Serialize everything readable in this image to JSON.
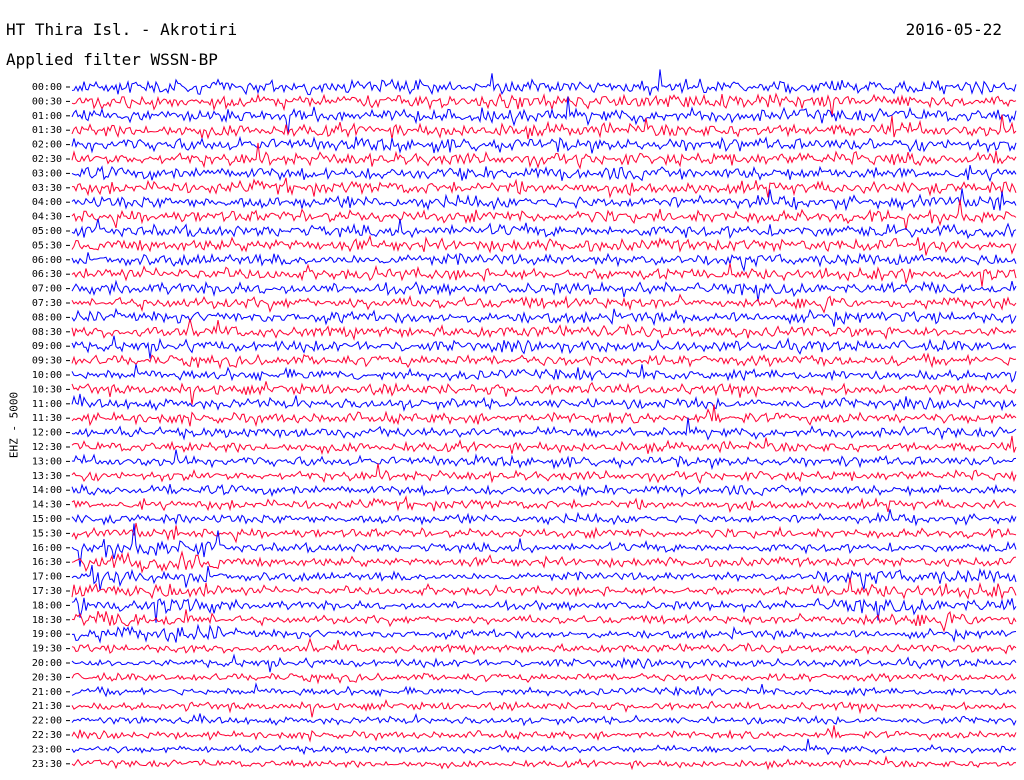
{
  "header": {
    "station_title": "HT Thira Isl. - Akrotiri",
    "date": "2016-05-22",
    "filter_label": "Applied filter WSSN-BP",
    "channel_label": "EHZ - 5000"
  },
  "colors": {
    "trace_a": "#0000ff",
    "trace_b": "#ff0033",
    "background": "#ffffff",
    "text": "#000000"
  },
  "chart_data": {
    "type": "line",
    "description_type": "helicorder",
    "y_tick_labels": [
      "00:00",
      "00:30",
      "01:00",
      "01:30",
      "02:00",
      "02:30",
      "03:00",
      "03:30",
      "04:00",
      "04:30",
      "05:00",
      "05:30",
      "06:00",
      "06:30",
      "07:00",
      "07:30",
      "08:00",
      "08:30",
      "09:00",
      "09:30",
      "10:00",
      "10:30",
      "11:00",
      "11:30",
      "12:00",
      "12:30",
      "13:00",
      "13:30",
      "14:00",
      "14:30",
      "15:00",
      "15:30",
      "16:00",
      "16:30",
      "17:00",
      "17:30",
      "18:00",
      "18:30",
      "19:00",
      "19:30",
      "20:00",
      "20:30",
      "21:00",
      "21:30",
      "22:00",
      "22:30",
      "23:00",
      "23:30"
    ],
    "trace_count": 48,
    "trace_colors_alternate": [
      "#0000ff",
      "#ff0033"
    ],
    "ylabel": "EHZ - 5000",
    "grid": false,
    "legend": "none"
  }
}
